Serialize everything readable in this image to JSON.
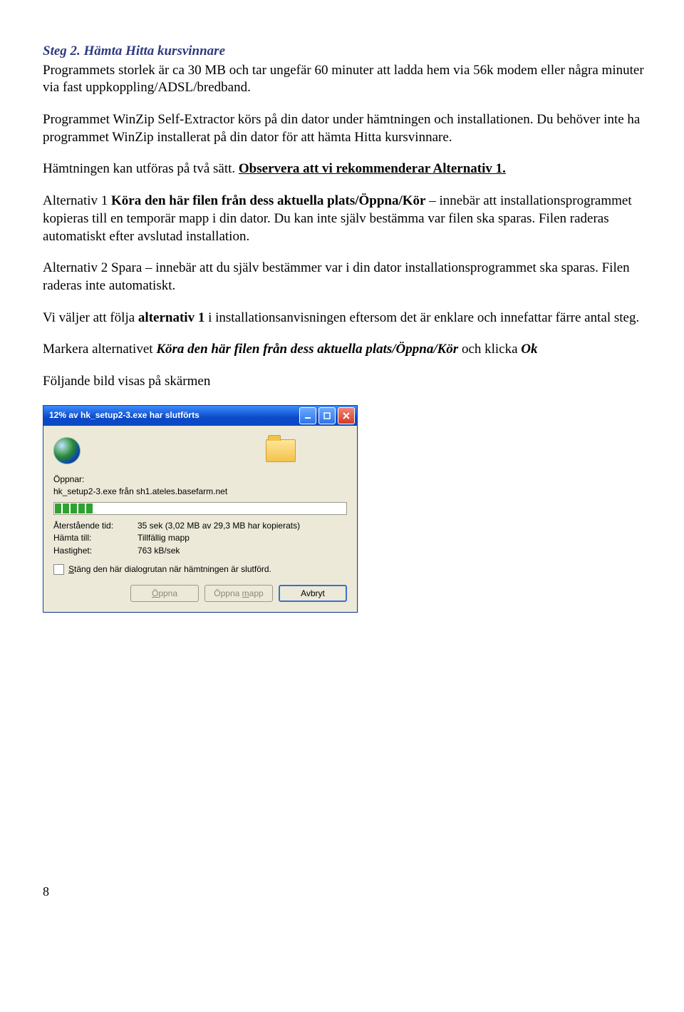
{
  "heading": "Steg 2. Hämta Hitta kursvinnare",
  "paragraphs": {
    "p1": "Programmets storlek är ca 30 MB och tar ungefär 60 minuter att ladda hem via 56k modem eller några minuter via fast uppkoppling/ADSL/bredband.",
    "p2": "Programmet WinZip Self-Extractor körs på din dator under hämtningen och installationen. Du behöver inte ha programmet WinZip installerat på din dator för att hämta Hitta kursvinnare.",
    "p3_a": "Hämtningen kan utföras på två sätt. ",
    "p3_b": "Observera att vi rekommenderar Alternativ 1.",
    "p4_a": "Alternativ 1 ",
    "p4_b": "Köra den här filen från dess aktuella plats/Öppna/Kör",
    "p4_c": " – innebär att installationsprogrammet kopieras till en temporär mapp i din dator. Du kan inte själv bestämma var filen ska sparas. Filen raderas automatiskt efter avslutad installation.",
    "p5": "Alternativ 2 Spara – innebär att du själv bestämmer var i din dator installationsprogrammet ska sparas. Filen raderas inte automatiskt.",
    "p6_a": "Vi väljer att följa ",
    "p6_b": "alternativ 1",
    "p6_c": " i installationsanvisningen eftersom det är enklare och innefattar färre antal steg.",
    "p7_a": "Markera alternativet ",
    "p7_b": "Köra den här filen från dess aktuella plats/Öppna/Kör",
    "p7_c": " och klicka ",
    "p7_d": "Ok",
    "p8": "Följande bild visas på skärmen"
  },
  "dialog": {
    "title": "12% av hk_setup2-3.exe har slutförts",
    "opening_label": "Öppnar:",
    "opening_value": "hk_setup2-3.exe från sh1.ateles.basefarm.net",
    "remaining_label": "Återstående tid:",
    "remaining_value": "35 sek (3,02 MB av 29,3 MB har kopierats)",
    "dest_label": "Hämta till:",
    "dest_value": "Tillfällig mapp",
    "speed_label": "Hastighet:",
    "speed_value": "763 kB/sek",
    "checkbox_prefix": "S",
    "checkbox_rest": "täng den här dialogrutan när hämtningen är slutförd.",
    "btn_open_pre": "Ö",
    "btn_open_rest": "ppna",
    "btn_openf_pre": "Öppna ",
    "btn_openf_u": "m",
    "btn_openf_rest": "app",
    "btn_cancel": "Avbryt"
  },
  "page_number": "8"
}
